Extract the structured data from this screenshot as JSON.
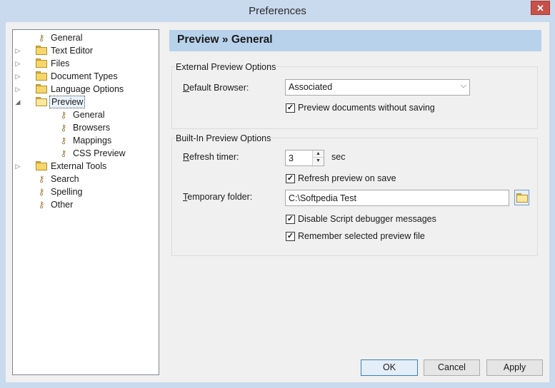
{
  "window": {
    "title": "Preferences",
    "close_glyph": "✕"
  },
  "tree": {
    "items": [
      {
        "label": "General",
        "icon": "wrench-icon",
        "expander": ""
      },
      {
        "label": "Text Editor",
        "icon": "folder-icon",
        "expander": "▷"
      },
      {
        "label": "Files",
        "icon": "folder-icon",
        "expander": "▷"
      },
      {
        "label": "Document Types",
        "icon": "folder-icon",
        "expander": "▷"
      },
      {
        "label": "Language Options",
        "icon": "folder-icon",
        "expander": "▷"
      },
      {
        "label": "Preview",
        "icon": "folder-open-icon",
        "expander": "◢"
      },
      {
        "label": "General",
        "icon": "wrench-icon",
        "expander": ""
      },
      {
        "label": "Browsers",
        "icon": "wrench-icon",
        "expander": ""
      },
      {
        "label": "Mappings",
        "icon": "wrench-icon",
        "expander": ""
      },
      {
        "label": "CSS Preview",
        "icon": "wrench-icon",
        "expander": ""
      },
      {
        "label": "External Tools",
        "icon": "folder-icon",
        "expander": "▷"
      },
      {
        "label": "Search",
        "icon": "wrench-icon",
        "expander": ""
      },
      {
        "label": "Spelling",
        "icon": "wrench-icon",
        "expander": ""
      },
      {
        "label": "Other",
        "icon": "wrench-icon",
        "expander": ""
      }
    ],
    "selected": "Preview"
  },
  "header": {
    "title": "Preview » General"
  },
  "external_group": {
    "title": "External Preview Options",
    "default_browser_label_pre": "",
    "default_browser_label_u": "D",
    "default_browser_label_post": "efault Browser:",
    "default_browser_value": "Associated",
    "preview_without_saving": {
      "label": "Preview documents without saving",
      "checked": true,
      "glyph": "✓"
    }
  },
  "builtin_group": {
    "title": "Built-In Preview Options",
    "refresh_label_u": "R",
    "refresh_label_post": "efresh timer:",
    "refresh_value": "3",
    "refresh_unit": "sec",
    "refresh_on_save": {
      "label": "Refresh preview on save",
      "checked": true,
      "glyph": "✓"
    },
    "temp_folder_label_u": "T",
    "temp_folder_label_post": "emporary folder:",
    "temp_folder_value": "C:\\Softpedia Test",
    "disable_script_debugger": {
      "label": "Disable Script debugger messages",
      "checked": true,
      "glyph": "✓"
    },
    "remember_preview_file": {
      "label": "Remember selected preview file",
      "checked": true,
      "glyph": "✓"
    }
  },
  "buttons": {
    "ok": "OK",
    "cancel": "Cancel",
    "apply": "Apply"
  },
  "colors": {
    "window_frame": "#c9d9ee",
    "header_bg": "#b8d2ec",
    "close": "#c7514a"
  }
}
